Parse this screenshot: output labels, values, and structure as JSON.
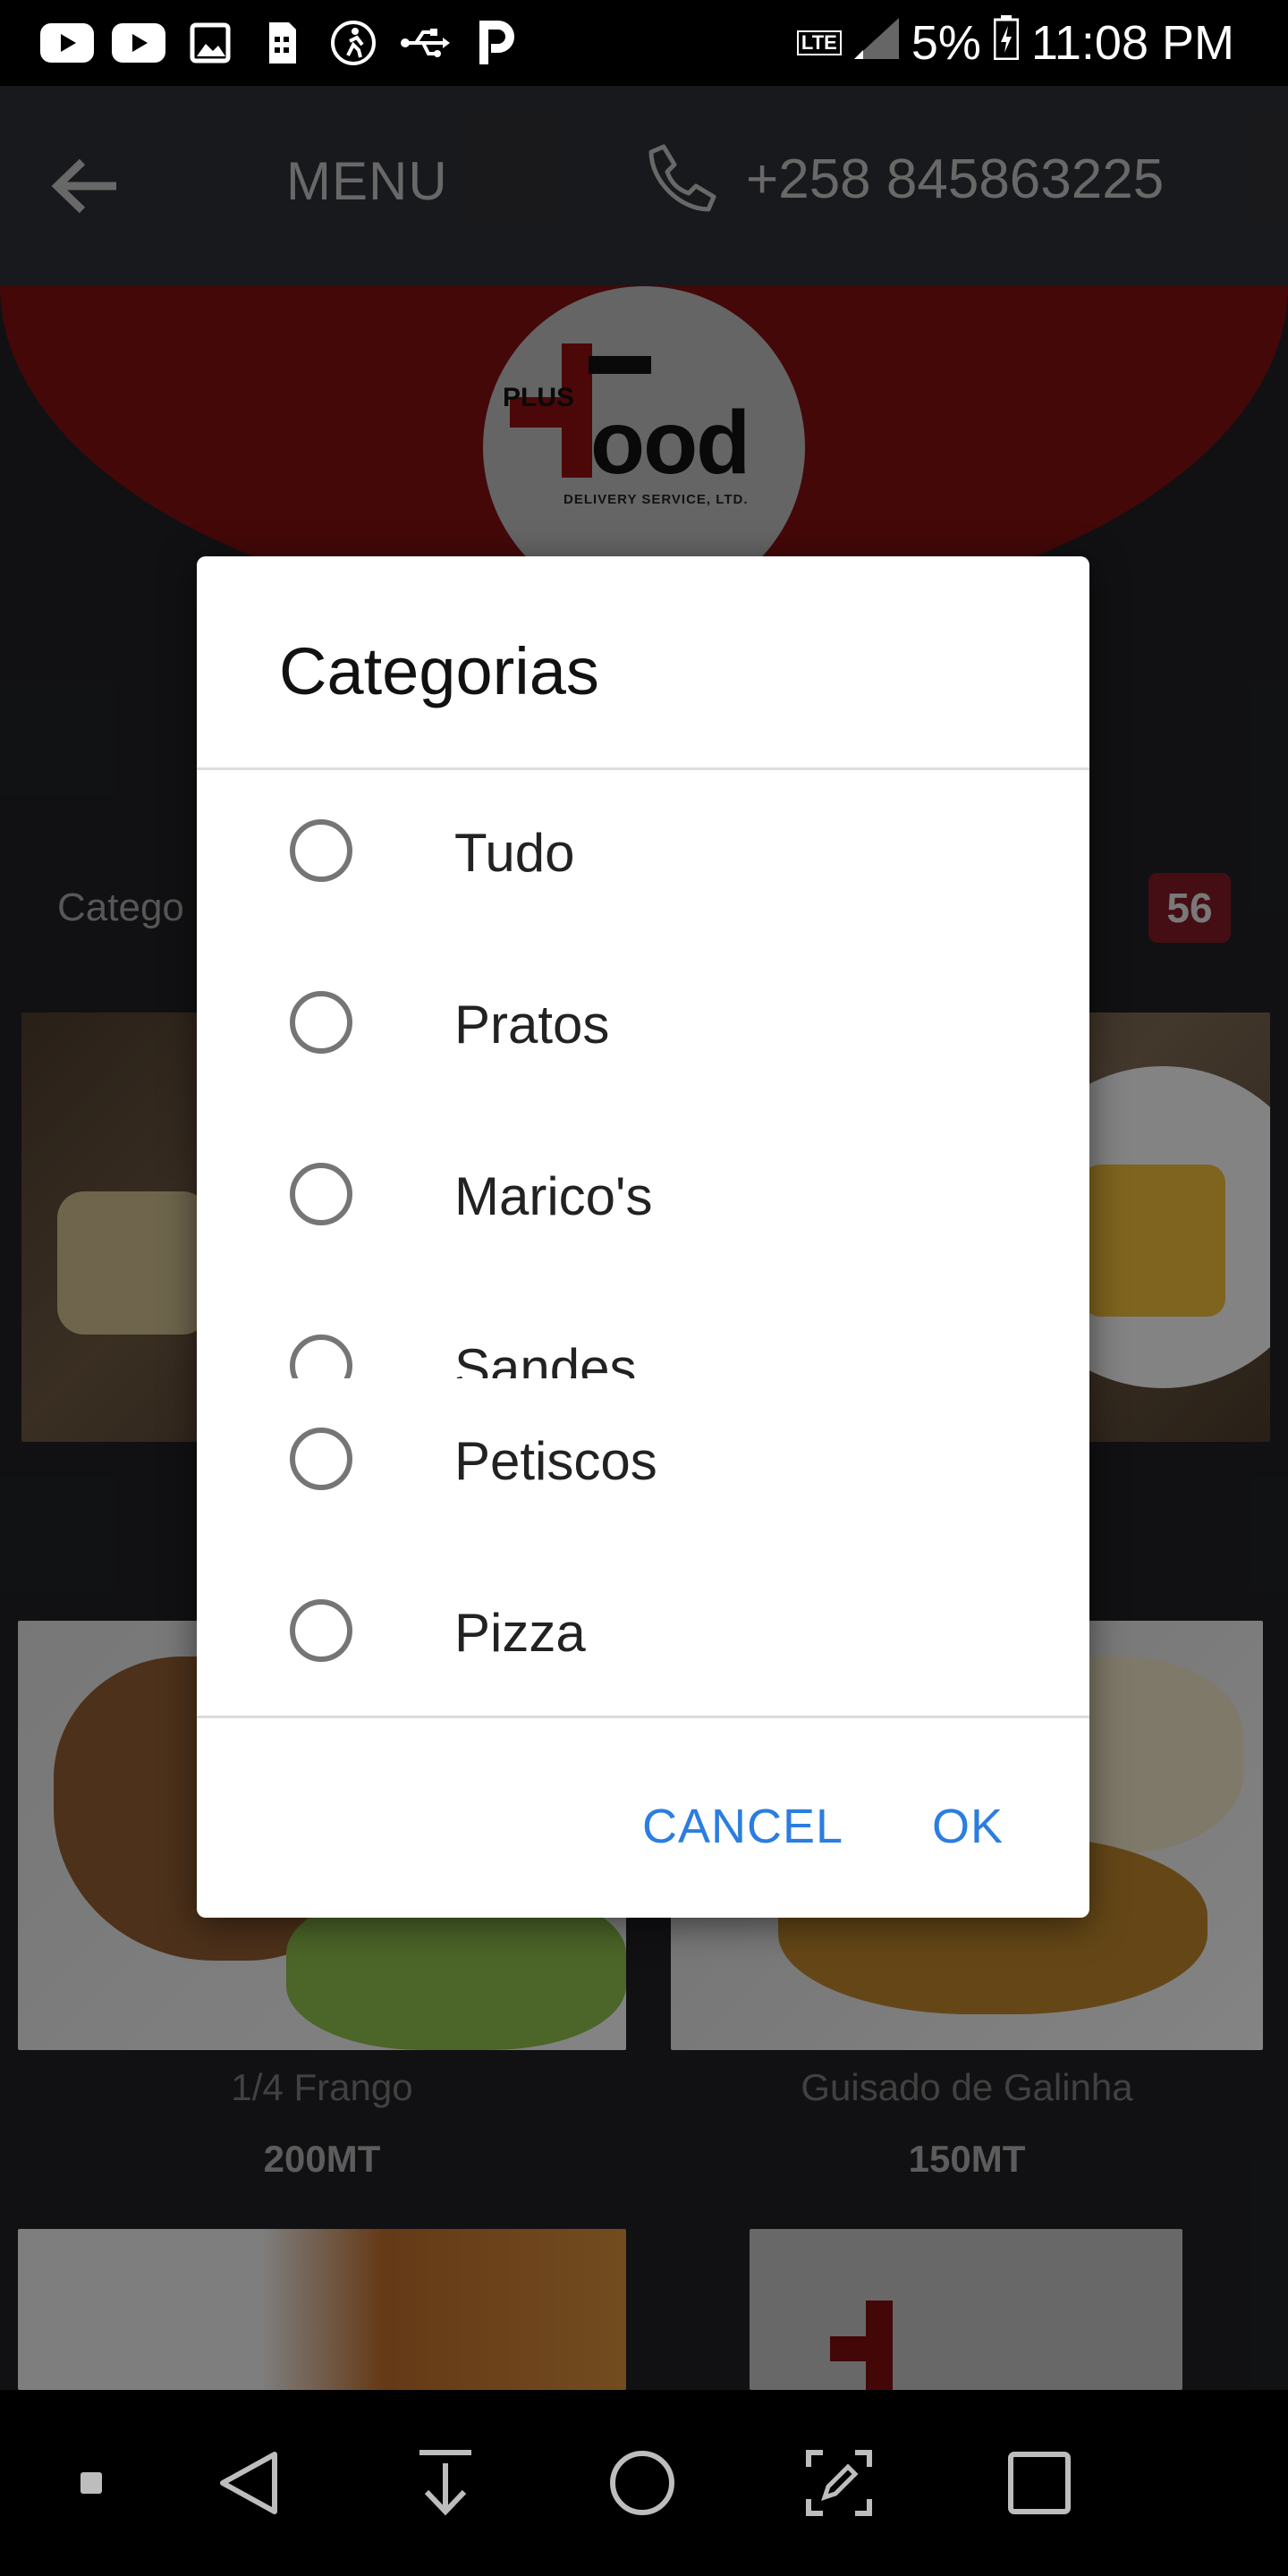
{
  "status_bar": {
    "icons_left": [
      "youtube-icon",
      "youtube-icon",
      "image-icon",
      "sim-icon",
      "accessibility-icon",
      "usb-icon",
      "p-icon"
    ],
    "network": "LTE",
    "battery_percent": "5%",
    "time": "11:08 PM"
  },
  "app_bar": {
    "back_icon": "arrow-left-icon",
    "title": "MENU",
    "phone_icon": "phone-icon",
    "phone_number": "+258 845863225"
  },
  "header": {
    "logo_plus": "PLUS",
    "logo_food": "ood",
    "logo_sub": "DELIVERY SERVICE, LTD.",
    "brand_color": "#8a0f10"
  },
  "catalog": {
    "category_label": "Catego",
    "count": "56",
    "items": [
      {
        "name": "1/4 Frango",
        "price": "200MT"
      },
      {
        "name": "Guisado de Galinha",
        "price": "150MT"
      }
    ]
  },
  "dialog": {
    "title": "Categorias",
    "options": [
      {
        "label": "Tudo",
        "selected": false
      },
      {
        "label": "Pratos",
        "selected": false
      },
      {
        "label": "Marico's",
        "selected": false
      },
      {
        "label": "Sandes",
        "selected": false
      },
      {
        "label": "Petiscos",
        "selected": false
      },
      {
        "label": "Pizza",
        "selected": false
      }
    ],
    "cancel_label": "CANCEL",
    "ok_label": "OK",
    "accent": "#2b7de0"
  },
  "nav_bar": {
    "icons": [
      "dot-icon",
      "back-triangle-icon",
      "download-icon",
      "home-circle-icon",
      "screenshot-edit-icon",
      "recents-square-icon"
    ]
  }
}
